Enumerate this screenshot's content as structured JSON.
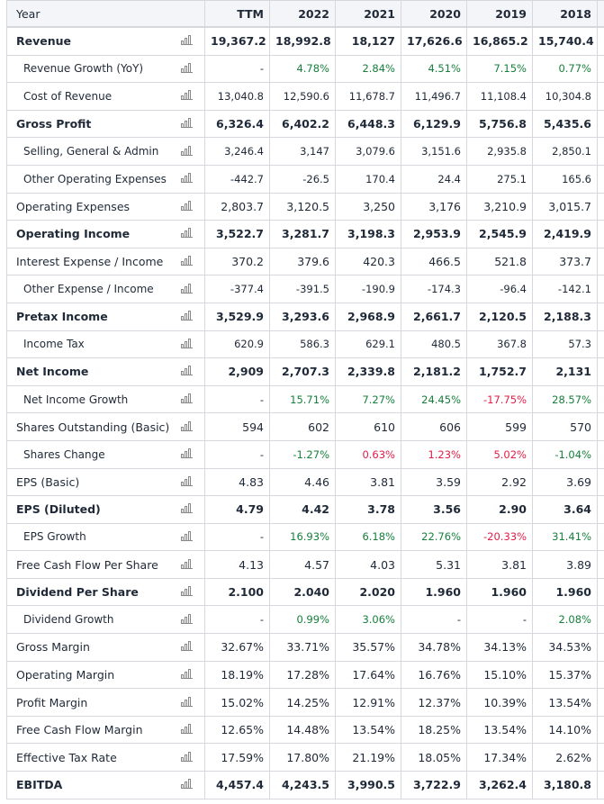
{
  "columns": [
    "Year",
    "TTM",
    "2022",
    "2021",
    "2020",
    "2019",
    "2018"
  ],
  "rows": [
    {
      "label": "Revenue",
      "style": "bold",
      "values": [
        "19,367.2",
        "18,992.8",
        "18,127",
        "17,626.6",
        "16,865.2",
        "15,740.4"
      ]
    },
    {
      "label": "Revenue Growth (YoY)",
      "style": "ind small",
      "values": [
        "-",
        "4.78%",
        "2.84%",
        "4.51%",
        "7.15%",
        "0.77%"
      ],
      "colors": [
        "",
        "g",
        "g",
        "g",
        "g",
        "g"
      ]
    },
    {
      "label": "Cost of Revenue",
      "style": "ind small",
      "values": [
        "13,040.8",
        "12,590.6",
        "11,678.7",
        "11,496.7",
        "11,108.4",
        "10,304.8"
      ]
    },
    {
      "label": "Gross Profit",
      "style": "bold",
      "values": [
        "6,326.4",
        "6,402.2",
        "6,448.3",
        "6,129.9",
        "5,756.8",
        "5,435.6"
      ]
    },
    {
      "label": "Selling, General & Admin",
      "style": "ind small",
      "values": [
        "3,246.4",
        "3,147",
        "3,079.6",
        "3,151.6",
        "2,935.8",
        "2,850.1"
      ]
    },
    {
      "label": "Other Operating Expenses",
      "style": "ind small",
      "values": [
        "-442.7",
        "-26.5",
        "170.4",
        "24.4",
        "275.1",
        "165.6"
      ]
    },
    {
      "label": "Operating Expenses",
      "style": "",
      "values": [
        "2,803.7",
        "3,120.5",
        "3,250",
        "3,176",
        "3,210.9",
        "3,015.7"
      ]
    },
    {
      "label": "Operating Income",
      "style": "bold",
      "values": [
        "3,522.7",
        "3,281.7",
        "3,198.3",
        "2,953.9",
        "2,545.9",
        "2,419.9"
      ]
    },
    {
      "label": "Interest Expense / Income",
      "style": "",
      "values": [
        "370.2",
        "379.6",
        "420.3",
        "466.5",
        "521.8",
        "373.7"
      ]
    },
    {
      "label": "Other Expense / Income",
      "style": "ind small",
      "values": [
        "-377.4",
        "-391.5",
        "-190.9",
        "-174.3",
        "-96.4",
        "-142.1"
      ]
    },
    {
      "label": "Pretax Income",
      "style": "bold",
      "values": [
        "3,529.9",
        "3,293.6",
        "2,968.9",
        "2,661.7",
        "2,120.5",
        "2,188.3"
      ]
    },
    {
      "label": "Income Tax",
      "style": "ind small",
      "values": [
        "620.9",
        "586.3",
        "629.1",
        "480.5",
        "367.8",
        "57.3"
      ]
    },
    {
      "label": "Net Income",
      "style": "bold",
      "values": [
        "2,909",
        "2,707.3",
        "2,339.8",
        "2,181.2",
        "1,752.7",
        "2,131"
      ]
    },
    {
      "label": "Net Income Growth",
      "style": "ind small",
      "values": [
        "-",
        "15.71%",
        "7.27%",
        "24.45%",
        "-17.75%",
        "28.57%"
      ],
      "colors": [
        "",
        "g",
        "g",
        "g",
        "r",
        "g"
      ]
    },
    {
      "label": "Shares Outstanding (Basic)",
      "style": "",
      "values": [
        "594",
        "602",
        "610",
        "606",
        "599",
        "570"
      ]
    },
    {
      "label": "Shares Change",
      "style": "ind small",
      "values": [
        "-",
        "-1.27%",
        "0.63%",
        "1.23%",
        "5.02%",
        "-1.04%"
      ],
      "colors": [
        "",
        "g",
        "r",
        "r",
        "r",
        "g"
      ]
    },
    {
      "label": "EPS (Basic)",
      "style": "",
      "values": [
        "4.83",
        "4.46",
        "3.81",
        "3.59",
        "2.92",
        "3.69"
      ]
    },
    {
      "label": "EPS (Diluted)",
      "style": "bold",
      "values": [
        "4.79",
        "4.42",
        "3.78",
        "3.56",
        "2.90",
        "3.64"
      ]
    },
    {
      "label": "EPS Growth",
      "style": "ind small",
      "values": [
        "-",
        "16.93%",
        "6.18%",
        "22.76%",
        "-20.33%",
        "31.41%"
      ],
      "colors": [
        "",
        "g",
        "g",
        "g",
        "r",
        "g"
      ]
    },
    {
      "label": "Free Cash Flow Per Share",
      "style": "",
      "values": [
        "4.13",
        "4.57",
        "4.03",
        "5.31",
        "3.81",
        "3.89"
      ]
    },
    {
      "label": "Dividend Per Share",
      "style": "bold",
      "values": [
        "2.100",
        "2.040",
        "2.020",
        "1.960",
        "1.960",
        "1.960"
      ]
    },
    {
      "label": "Dividend Growth",
      "style": "ind small",
      "values": [
        "-",
        "0.99%",
        "3.06%",
        "-",
        "-",
        "2.08%"
      ],
      "colors": [
        "",
        "g",
        "g",
        "",
        "",
        "g"
      ]
    },
    {
      "label": "Gross Margin",
      "style": "",
      "values": [
        "32.67%",
        "33.71%",
        "35.57%",
        "34.78%",
        "34.13%",
        "34.53%"
      ]
    },
    {
      "label": "Operating Margin",
      "style": "",
      "values": [
        "18.19%",
        "17.28%",
        "17.64%",
        "16.76%",
        "15.10%",
        "15.37%"
      ]
    },
    {
      "label": "Profit Margin",
      "style": "",
      "values": [
        "15.02%",
        "14.25%",
        "12.91%",
        "12.37%",
        "10.39%",
        "13.54%"
      ]
    },
    {
      "label": "Free Cash Flow Margin",
      "style": "",
      "values": [
        "12.65%",
        "14.48%",
        "13.54%",
        "18.25%",
        "13.54%",
        "14.10%"
      ]
    },
    {
      "label": "Effective Tax Rate",
      "style": "",
      "values": [
        "17.59%",
        "17.80%",
        "21.19%",
        "18.05%",
        "17.34%",
        "2.62%"
      ]
    },
    {
      "label": "EBITDA",
      "style": "bold",
      "values": [
        "4,457.4",
        "4,243.5",
        "3,990.5",
        "3,722.9",
        "3,262.4",
        "3,180.8"
      ]
    }
  ],
  "colors": {
    "positive": "#16803c",
    "negative": "#e11d48"
  },
  "icon": "bar-chart-icon"
}
